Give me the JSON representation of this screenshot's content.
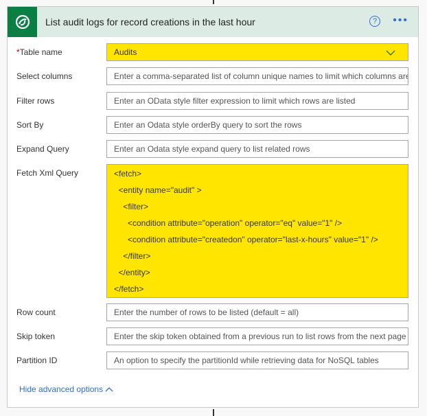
{
  "action": {
    "title": "List audit logs for record creations in the last hour",
    "brand_color": "#0b7f43",
    "header_bg": "#dcece4",
    "highlight_color": "#ffe500"
  },
  "fields": {
    "table_name": {
      "label": "Table name",
      "required": "*",
      "value": "Audits"
    },
    "select_columns": {
      "label": "Select columns",
      "placeholder": "Enter a comma-separated list of column unique names to limit which columns are listed"
    },
    "filter_rows": {
      "label": "Filter rows",
      "placeholder": "Enter an OData style filter expression to limit which rows are listed"
    },
    "sort_by": {
      "label": "Sort By",
      "placeholder": "Enter an Odata style orderBy query to sort the rows"
    },
    "expand_query": {
      "label": "Expand Query",
      "placeholder": "Enter an Odata style expand query to list related rows"
    },
    "fetch_xml": {
      "label": "Fetch Xml Query",
      "lines": [
        "<fetch>",
        "  <entity name=\"audit\" >",
        "    <filter>",
        "      <condition attribute=\"operation\" operator=\"eq\" value=\"1\" />",
        "      <condition attribute=\"createdon\" operator=\"last-x-hours\" value=\"1\" />",
        "    </filter>",
        "  </entity>",
        "</fetch>"
      ]
    },
    "row_count": {
      "label": "Row count",
      "placeholder": "Enter the number of rows to be listed (default = all)"
    },
    "skip_token": {
      "label": "Skip token",
      "placeholder": "Enter the skip token obtained from a previous run to list rows from the next page"
    },
    "partition_id": {
      "label": "Partition ID",
      "placeholder": "An option to specify the partitionId while retrieving data for NoSQL tables"
    }
  },
  "hide_advanced": "Hide advanced options"
}
